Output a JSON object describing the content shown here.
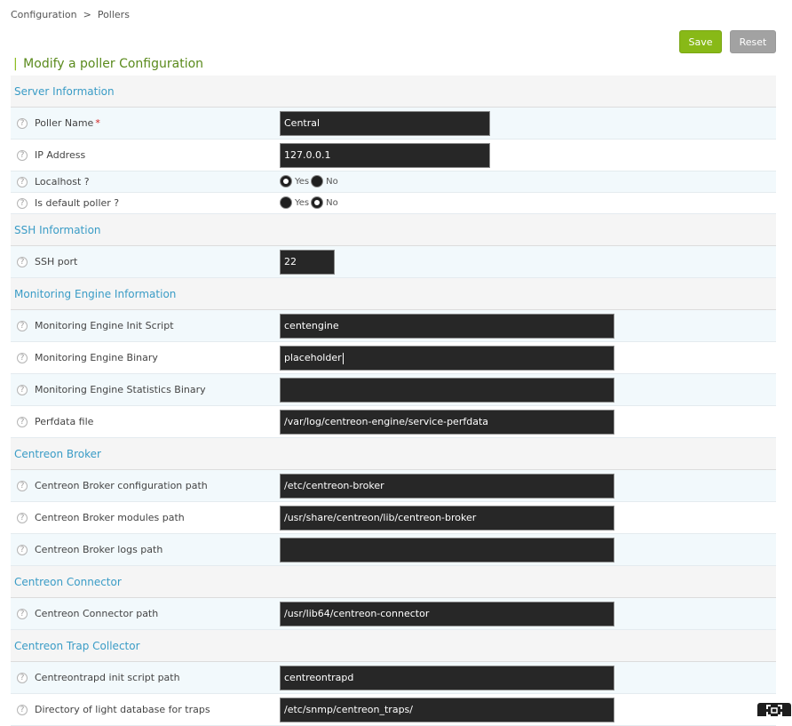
{
  "breadcrumb": {
    "items": [
      "Configuration",
      "Pollers"
    ],
    "separator": ">"
  },
  "toolbar": {
    "save_label": "Save",
    "reset_label": "Reset"
  },
  "form": {
    "title": "Modify a poller Configuration"
  },
  "sections": {
    "server": {
      "title": "Server Information",
      "poller_name": {
        "label": "Poller Name",
        "required": "*",
        "value": "Central"
      },
      "ip_address": {
        "label": "IP Address",
        "value": "127.0.0.1"
      },
      "localhost": {
        "label": "Localhost ?",
        "yes": "Yes",
        "no": "No",
        "selected": "Yes"
      },
      "default_poller": {
        "label": "Is default poller ?",
        "yes": "Yes",
        "no": "No",
        "selected": "No"
      }
    },
    "ssh": {
      "title": "SSH Information",
      "port": {
        "label": "SSH port",
        "value": "22"
      }
    },
    "engine": {
      "title": "Monitoring Engine Information",
      "init_script": {
        "label": "Monitoring Engine Init Script",
        "value": "centengine"
      },
      "binary": {
        "label": "Monitoring Engine Binary",
        "value": "placeholder"
      },
      "stats_binary": {
        "label": "Monitoring Engine Statistics Binary",
        "value": ""
      },
      "perfdata": {
        "label": "Perfdata file",
        "value": "/var/log/centreon-engine/service-perfdata"
      }
    },
    "broker": {
      "title": "Centreon Broker",
      "config_path": {
        "label": "Centreon Broker configuration path",
        "value": "/etc/centreon-broker"
      },
      "modules_path": {
        "label": "Centreon Broker modules path",
        "value": "/usr/share/centreon/lib/centreon-broker"
      },
      "logs_path": {
        "label": "Centreon Broker logs path",
        "value": ""
      }
    },
    "connector": {
      "title": "Centreon Connector",
      "path": {
        "label": "Centreon Connector path",
        "value": "/usr/lib64/centreon-connector"
      }
    },
    "trap": {
      "title": "Centreon Trap Collector",
      "init_script": {
        "label": "Centreontrapd init script path",
        "value": "centreontrapd"
      },
      "db_dir": {
        "label": "Directory of light database for traps",
        "value": "/etc/snmp/centreon_traps/"
      }
    }
  },
  "icons": {
    "help": "question-mark-icon",
    "corner": "fullscreen-icon"
  }
}
